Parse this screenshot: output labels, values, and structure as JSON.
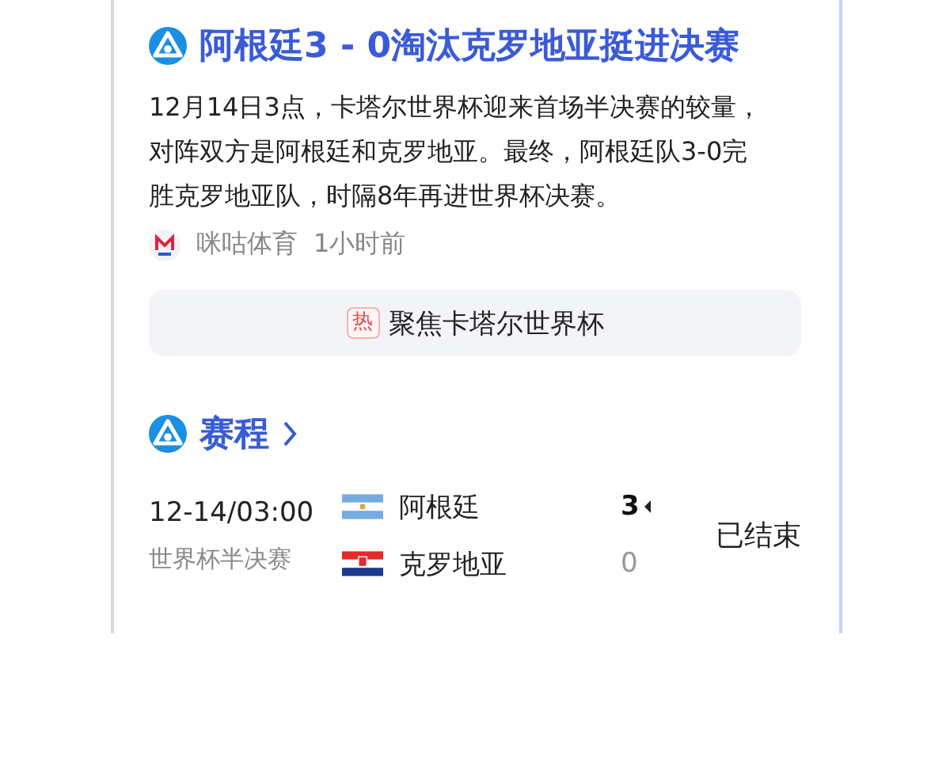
{
  "article": {
    "title": "阿根廷3 - 0淘汰克罗地亚挺进决赛",
    "summary": "12月14日3点，卡塔尔世界杯迎来首场半决赛的较量，对阵双方是阿根廷和克罗地亚。最终，阿根廷队3-0完胜克罗地亚队，时隔8年再进世界杯决赛。",
    "source": "咪咕体育",
    "time": "1小时前"
  },
  "topic": {
    "badge": "热",
    "label": "聚焦卡塔尔世界杯"
  },
  "schedule": {
    "title": "赛程"
  },
  "match": {
    "time": "12-14/03:00",
    "stage": "世界杯半决赛",
    "status": "已结束",
    "teams": [
      {
        "name": "阿根廷",
        "kind": "argentina",
        "score": "3",
        "winner": true
      },
      {
        "name": "克罗地亚",
        "kind": "croatia",
        "score": "0",
        "winner": false
      }
    ]
  }
}
